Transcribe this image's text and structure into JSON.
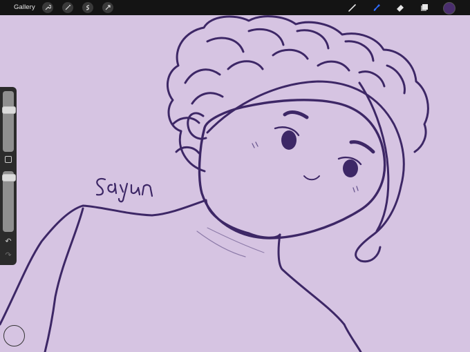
{
  "topbar": {
    "gallery_label": "Gallery",
    "left_tools": [
      "wrench-icon",
      "magic-wand-icon",
      "selection-icon",
      "transform-icon"
    ],
    "right_tools": [
      "brush-icon",
      "smudge-icon",
      "eraser-icon",
      "layers-icon"
    ],
    "active_tool": "smudge-icon",
    "current_color": "#4a2e6e",
    "active_color": "#2f6bff"
  },
  "canvas": {
    "background": "#d6c4e2",
    "stroke_color": "#3d2766",
    "signature_text": "Sayun"
  },
  "sidebar": {
    "undo_symbol": "↶",
    "redo_symbol": "↷",
    "brush_size_level": 0.72,
    "opacity_level": 0.95
  }
}
